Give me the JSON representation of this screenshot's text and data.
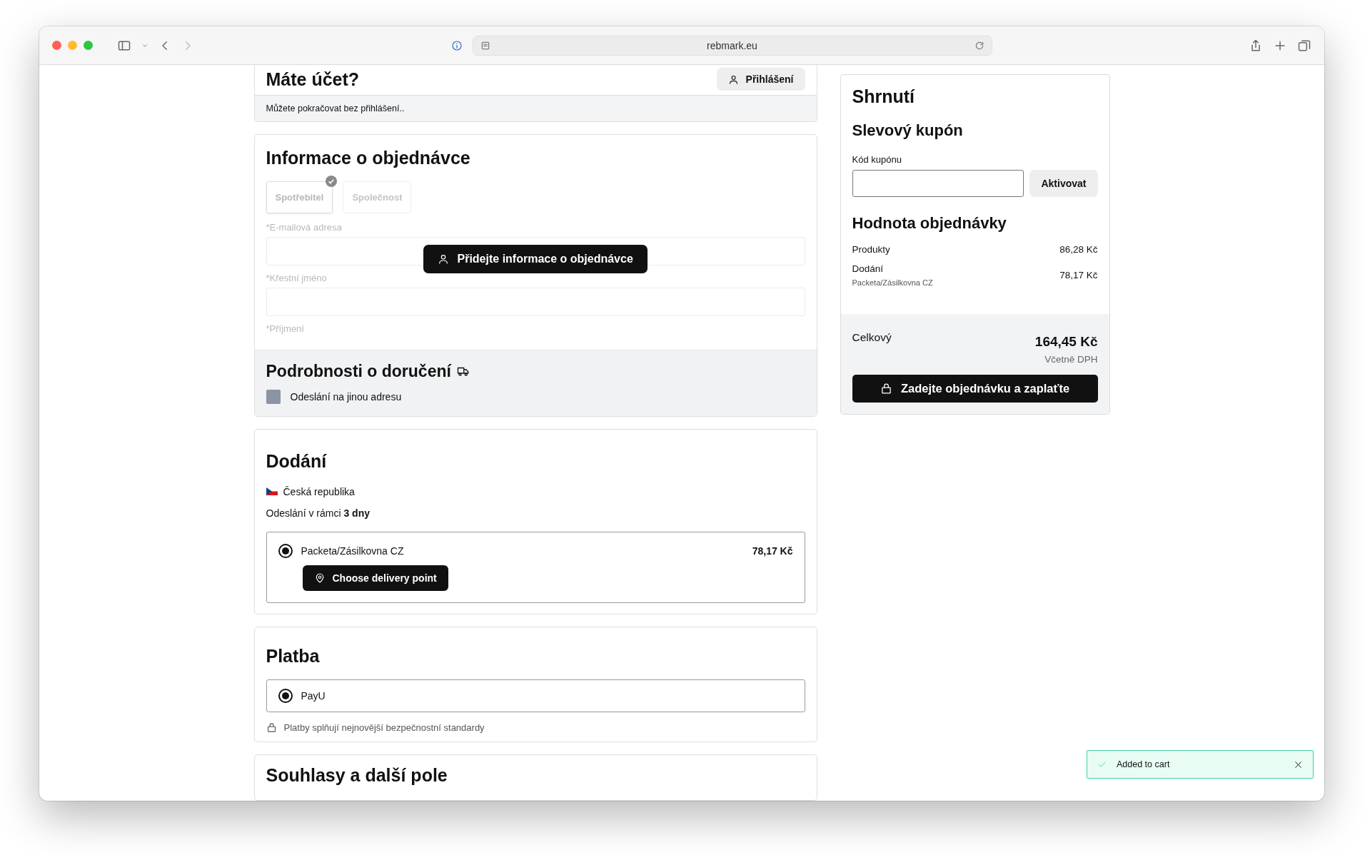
{
  "browser": {
    "url": "rebmark.eu"
  },
  "login_card": {
    "title": "Máte účet?",
    "button": "Přihlášení",
    "note": "Můžete pokračovat bez přihlášení.."
  },
  "order_info": {
    "title": "Informace o objednávce",
    "customer_types": [
      {
        "label": "Spotřebitel",
        "selected": true
      },
      {
        "label": "Společnost",
        "selected": false
      }
    ],
    "fields": [
      {
        "label": "*E-mailová adresa"
      },
      {
        "label": "*Křestní jméno"
      },
      {
        "label": "*Příjmení"
      }
    ],
    "overlay_button": "Přidejte informace o objednávce",
    "delivery_details": {
      "title": "Podrobnosti o doručení",
      "checkbox": {
        "label": "Odeslání na jinou adresu",
        "checked": false
      }
    }
  },
  "delivery": {
    "title": "Dodání",
    "country": "Česká republika",
    "shipping_note": "Odeslání v rámci **3 dny**",
    "options": [
      {
        "name": "Packeta/Zásilkovna CZ",
        "price": "78,17 Kč",
        "selected": true,
        "button": "Choose delivery point"
      }
    ]
  },
  "payment": {
    "title": "Platba",
    "options": [
      {
        "name": "PayU",
        "selected": true
      }
    ],
    "security_note": "Platby splňují nejnovější bezpečnostní standardy"
  },
  "consents": {
    "title": "Souhlasy a další pole"
  },
  "summary": {
    "title": "Shrnutí",
    "coupon_title": "Slevový kupón",
    "coupon_label": "Kód kupónu",
    "coupon_button": "Aktivovat",
    "value_title": "Hodnota objednávky",
    "lines": [
      {
        "label": "Produkty",
        "value": "86,28 Kč"
      },
      {
        "label": "Dodání",
        "sublabel": "Packeta/Zásilkovna CZ",
        "value": "78,17 Kč"
      }
    ],
    "total_label": "Celkový",
    "total": "164,45 Kč",
    "tax_note": "Včetně DPH",
    "checkout_button": "Zadejte objednávku a zaplaťte"
  },
  "toast": {
    "message": "Added to cart"
  }
}
